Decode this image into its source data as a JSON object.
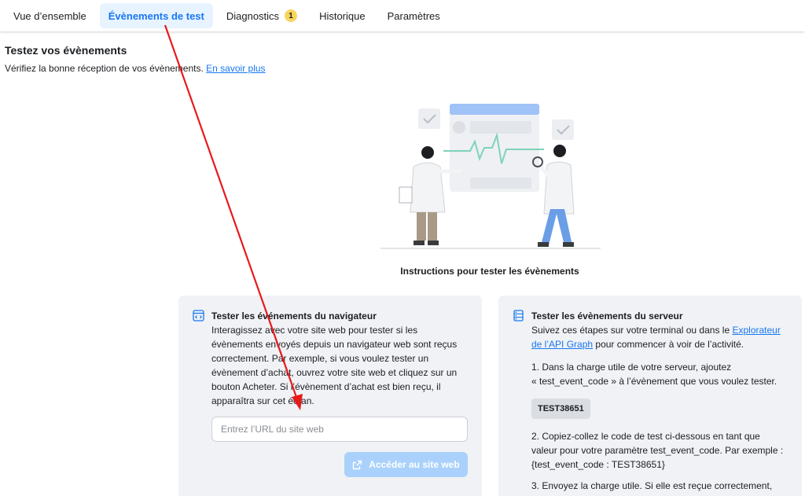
{
  "tabs": [
    {
      "label": "Vue d’ensemble"
    },
    {
      "label": "Évènements de test",
      "active": true
    },
    {
      "label": "Diagnostics",
      "badge": "1"
    },
    {
      "label": "Historique"
    },
    {
      "label": "Paramètres"
    }
  ],
  "header": {
    "title": "Testez vos évènements",
    "subtitle": "Vérifiez la bonne réception de vos évènements.",
    "learn_more": "En savoir plus"
  },
  "instructions_title": "Instructions pour tester les évènements",
  "browser_card": {
    "icon": "code-window-icon",
    "title": "Tester les événements du navigateur",
    "lines": [
      "Interagissez avec votre site web pour tester si les",
      "évènements envoyés depuis un navigateur web sont reçus",
      "correctement. Par exemple, si vous voulez tester un",
      "évènement d’achat, ouvrez votre site web et cliquez sur un",
      "bouton Acheter. Si l’évènement d’achat est bien reçu, il",
      "apparaîtra sur cet écran."
    ],
    "url_placeholder": "Entrez l’URL du site web",
    "button_label": "Accéder au site web"
  },
  "server_card": {
    "icon": "server-icon",
    "title": "Tester les évènements du serveur",
    "intro_1": "Suivez ces étapes sur votre terminal ou dans le",
    "intro_link_1": "Explorateur",
    "intro_link_2": "de l’API Graph",
    "intro_2": "pour commencer à voir de l’activité.",
    "step1_lines": [
      "1. Dans la charge utile de votre serveur, ajoutez",
      "« test_event_code » à l’évènement que vous voulez tester."
    ],
    "code": "TEST38651",
    "step2_lines": [
      "2. Copiez-collez le code de test ci-dessous en tant que",
      "valeur pour votre paramètre test_event_code. Par exemple :",
      "{test_event_code : TEST38651}"
    ],
    "step3_line": "3. Envoyez la charge utile. Si elle est reçue correctement,"
  },
  "colors": {
    "accent": "#1877f2",
    "annotation_arrow": "#e8191b",
    "card_bg": "#f0f2f5",
    "badge": "#f7d55d"
  }
}
